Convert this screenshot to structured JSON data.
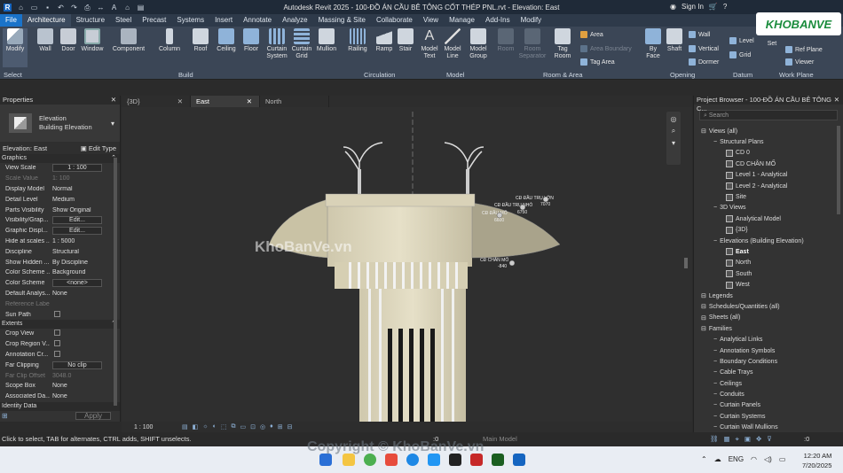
{
  "window": {
    "title": "Autodesk Revit 2025 - 100-ĐỒ ÁN CẦU BÊ TÔNG CỐT THÉP PNL.rvt - Elevation: East",
    "sign_in": "Sign In"
  },
  "tabs": [
    "File",
    "Architecture",
    "Structure",
    "Steel",
    "Precast",
    "Systems",
    "Insert",
    "Annotate",
    "Analyze",
    "Massing & Site",
    "Collaborate",
    "View",
    "Manage",
    "Add-Ins",
    "Modify"
  ],
  "ribbon": {
    "buttons": [
      {
        "label": "Modify"
      },
      {
        "label": "Wall"
      },
      {
        "label": "Door"
      },
      {
        "label": "Window"
      },
      {
        "label": "Component"
      },
      {
        "label": "Column"
      },
      {
        "label": "Roof"
      },
      {
        "label": "Ceiling"
      },
      {
        "label": "Floor"
      },
      {
        "label": "Curtain\nSystem"
      },
      {
        "label": "Curtain\nGrid"
      },
      {
        "label": "Mullion"
      },
      {
        "label": "Railing"
      },
      {
        "label": "Ramp"
      },
      {
        "label": "Stair"
      },
      {
        "label": "Model\nText"
      },
      {
        "label": "Model\nLine"
      },
      {
        "label": "Model\nGroup"
      },
      {
        "label": "Room"
      },
      {
        "label": "Room\nSeparator"
      },
      {
        "label": "Tag\nRoom"
      },
      {
        "label": "By\nFace"
      },
      {
        "label": "Shaft"
      },
      {
        "label": "Set"
      }
    ],
    "small": {
      "area": "Area",
      "area_boundary": "Area Boundary",
      "tag_area": "Tag Area",
      "wall": "Wall",
      "vertical": "Vertical",
      "dormer": "Dormer",
      "level": "Level",
      "grid": "Grid",
      "ref_plane": "Ref Plane",
      "viewer": "Viewer"
    },
    "panels": {
      "select": "Select",
      "build": "Build",
      "circulation": "Circulation",
      "model": "Model",
      "room_area": "Room & Area",
      "opening": "Opening",
      "datum": "Datum",
      "work_plane": "Work Plane"
    }
  },
  "properties": {
    "header": "Properties",
    "type_name": "Elevation",
    "type_sub": "Building Elevation",
    "selector": "Elevation: East",
    "edit_type": "Edit Type",
    "sections": {
      "graphics": "Graphics",
      "extents": "Extents",
      "identity": "Identity Data"
    },
    "graphics": [
      {
        "k": "View Scale",
        "v": "1 : 100"
      },
      {
        "k": "Scale Value",
        "v": "1:  100"
      },
      {
        "k": "Display Model",
        "v": "Normal"
      },
      {
        "k": "Detail Level",
        "v": "Medium"
      },
      {
        "k": "Parts Visibility",
        "v": "Show Original"
      },
      {
        "k": "Visibility/Grap...",
        "v": "Edit..."
      },
      {
        "k": "Graphic Displ...",
        "v": "Edit..."
      },
      {
        "k": "Hide at scales ...",
        "v": "1 : 5000"
      },
      {
        "k": "Discipline",
        "v": "Structural"
      },
      {
        "k": "Show Hidden ...",
        "v": "By Discipline"
      },
      {
        "k": "Color Scheme ...",
        "v": "Background"
      },
      {
        "k": "Color Scheme",
        "v": "<none>"
      },
      {
        "k": "Default Analys...",
        "v": "None"
      },
      {
        "k": "Reference Label",
        "v": ""
      },
      {
        "k": "Sun Path",
        "v": ""
      }
    ],
    "extents": [
      {
        "k": "Crop View",
        "v": ""
      },
      {
        "k": "Crop Region V...",
        "v": ""
      },
      {
        "k": "Annotation Cr...",
        "v": ""
      },
      {
        "k": "Far Clipping",
        "v": "No clip"
      },
      {
        "k": "Far Clip Offset",
        "v": "3048.0"
      },
      {
        "k": "Scope Box",
        "v": "None"
      },
      {
        "k": "Associated Da...",
        "v": "None"
      }
    ],
    "apply": "Apply"
  },
  "doc_tabs": [
    "{3D}",
    "East",
    "North"
  ],
  "canvas": {
    "annotations": [
      "CĐ ĐẦU TRỤ LỚN",
      "7070",
      "CĐ ĐẦU TRỤ NHỎ",
      "6750",
      "CĐ ĐẦU MỐ",
      "6600",
      "CĐ CHÂN MỐ",
      "-840"
    ],
    "watermark": "KhoBanVe.vn"
  },
  "view_bar": {
    "scale": "1 : 100",
    "model": "Main Model",
    "count": ":0"
  },
  "browser": {
    "header": "Project Browser - 100-ĐỒ ÁN CẦU BÊ TÔNG C...",
    "search": "Search",
    "items": [
      {
        "t": "Views (all)",
        "d": 0
      },
      {
        "t": "Structural Plans",
        "d": 1
      },
      {
        "t": "CD 0",
        "d": 2
      },
      {
        "t": "CD CHÂN MỐ",
        "d": 2
      },
      {
        "t": "Level 1 - Analytical",
        "d": 2
      },
      {
        "t": "Level 2 - Analytical",
        "d": 2
      },
      {
        "t": "Site",
        "d": 2
      },
      {
        "t": "3D Views",
        "d": 1
      },
      {
        "t": "Analytical Model",
        "d": 2
      },
      {
        "t": "{3D}",
        "d": 2
      },
      {
        "t": "Elevations (Building Elevation)",
        "d": 1
      },
      {
        "t": "East",
        "d": 2
      },
      {
        "t": "North",
        "d": 2
      },
      {
        "t": "South",
        "d": 2
      },
      {
        "t": "West",
        "d": 2
      },
      {
        "t": "Legends",
        "d": 0
      },
      {
        "t": "Schedules/Quantities (all)",
        "d": 0
      },
      {
        "t": "Sheets (all)",
        "d": 0
      },
      {
        "t": "Families",
        "d": 0
      },
      {
        "t": "Analytical Links",
        "d": 1
      },
      {
        "t": "Annotation Symbols",
        "d": 1
      },
      {
        "t": "Boundary Conditions",
        "d": 1
      },
      {
        "t": "Cable Trays",
        "d": 1
      },
      {
        "t": "Ceilings",
        "d": 1
      },
      {
        "t": "Conduits",
        "d": 1
      },
      {
        "t": "Curtain Panels",
        "d": 1
      },
      {
        "t": "Curtain Systems",
        "d": 1
      },
      {
        "t": "Curtain Wall Mullions",
        "d": 1
      }
    ]
  },
  "status": {
    "text": "Click to select, TAB for alternates, CTRL adds, SHIFT unselects.",
    "count": ":0"
  },
  "taskbar": {
    "lang": "ENG",
    "time": "12:20 AM",
    "date": "7/20/2025",
    "copyright": "Copyright © KhoBanVe.vn"
  },
  "brand": {
    "logo": "KHOBANVE",
    "accent": "#1a73c9"
  }
}
